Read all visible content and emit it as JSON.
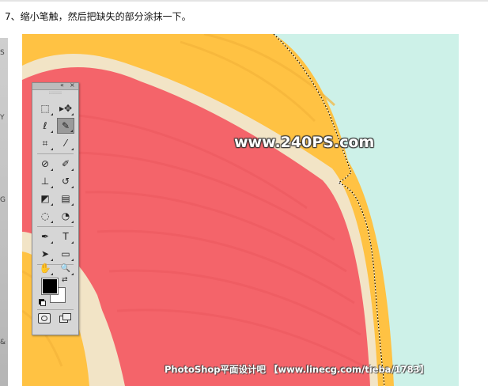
{
  "step": {
    "text": "7、缩小笔触，然后把缺失的部分涂抹一下。"
  },
  "left_strip": {
    "letters": [
      "S",
      "Y",
      "G",
      "&"
    ]
  },
  "watermark": {
    "text": "www.240PS.com"
  },
  "credit": {
    "text": "PhotoShop平面设计吧 【www.linecg.com/tieba/1783】"
  },
  "toolbox": {
    "collapse": "«",
    "close": "×",
    "grip": "::::::::",
    "tools": [
      {
        "name": "marquee-tool",
        "glyph": "⬚"
      },
      {
        "name": "move-tool",
        "glyph": "▸✥"
      },
      {
        "name": "lasso-tool",
        "glyph": "ℓ"
      },
      {
        "name": "quick-selection-tool",
        "glyph": "✎"
      },
      {
        "name": "crop-tool",
        "glyph": "⌗"
      },
      {
        "name": "eyedropper-tool",
        "glyph": "⁄"
      },
      {
        "name": "healing-brush-tool",
        "glyph": "⊘"
      },
      {
        "name": "brush-tool",
        "glyph": "✐"
      },
      {
        "name": "clone-stamp-tool",
        "glyph": "⊥"
      },
      {
        "name": "history-brush-tool",
        "glyph": "↺"
      },
      {
        "name": "eraser-tool",
        "glyph": "◩"
      },
      {
        "name": "gradient-tool",
        "glyph": "▤"
      },
      {
        "name": "blur-tool",
        "glyph": "◌"
      },
      {
        "name": "dodge-tool",
        "glyph": "◔"
      },
      {
        "name": "pen-tool",
        "glyph": "✒"
      },
      {
        "name": "type-tool",
        "glyph": "T"
      },
      {
        "name": "path-selection-tool",
        "glyph": "➤"
      },
      {
        "name": "shape-tool",
        "glyph": "▭"
      },
      {
        "name": "hand-tool",
        "glyph": "✋"
      },
      {
        "name": "zoom-tool",
        "glyph": "🔍"
      }
    ],
    "active_tool": "quick-selection-tool",
    "foreground_color": "#000000",
    "background_color": "#ffffff"
  }
}
